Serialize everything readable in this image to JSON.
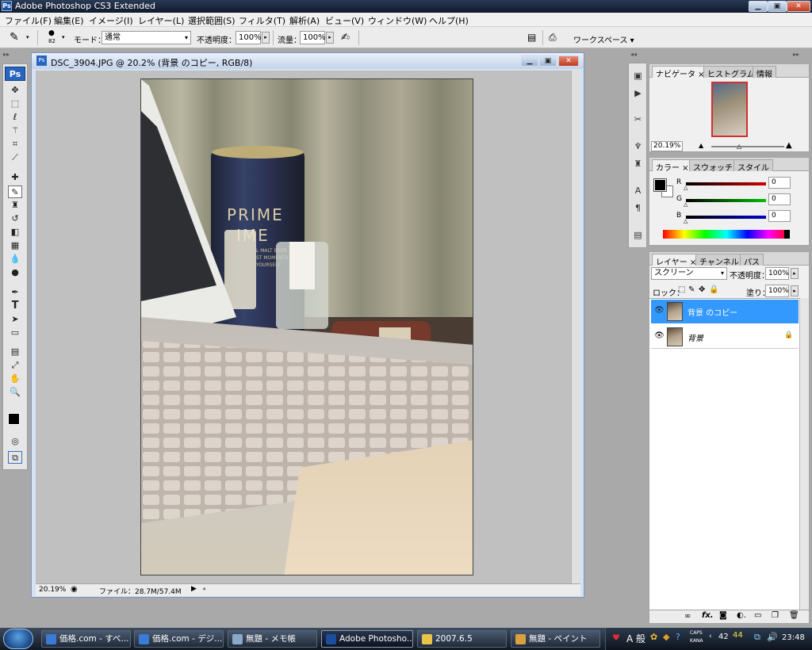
{
  "app": {
    "title": "Adobe Photoshop CS3 Extended",
    "logo": "Ps"
  },
  "menu": [
    "ファイル(F)",
    "編集(E)",
    "イメージ(I)",
    "レイヤー(L)",
    "選択範囲(S)",
    "フィルタ(T)",
    "解析(A)",
    "ビュー(V)",
    "ウィンドウ(W)",
    "ヘルプ(H)"
  ],
  "options": {
    "brush_size": "82",
    "mode_label": "モード：",
    "mode_value": "通常",
    "opacity_label": "不透明度：",
    "opacity_value": "100%",
    "flow_label": "流量：",
    "flow_value": "100%",
    "workspace": "ワークスペース ▾"
  },
  "document": {
    "title": "DSC_3904.JPG @ 20.2% (背景 のコピー, RGB/8)",
    "zoom": "20.19%",
    "file_info": "ファイル：28.7M/57.4M"
  },
  "photo": {
    "can_text_1": "PRIME",
    "can_text_2": "IME",
    "can_small_1": "L MALT BEER",
    "can_small_2": "ST MOMENTS",
    "can_small_3": "YOURSELF"
  },
  "navigator": {
    "tabs": [
      "ナビゲータ",
      "ヒストグラム",
      "情報"
    ],
    "zoom": "20.19%"
  },
  "color": {
    "tabs": [
      "カラー",
      "スウォッチ",
      "スタイル"
    ],
    "r_label": "R",
    "g_label": "G",
    "b_label": "B",
    "r": "0",
    "g": "0",
    "b": "0",
    "r_color": "#d00000",
    "g_color": "#00a000",
    "b_color": "#0000c8"
  },
  "layers": {
    "tabs": [
      "レイヤー",
      "チャンネル",
      "パス"
    ],
    "blend": "スクリーン",
    "opacity_label": "不透明度：",
    "opacity": "100%",
    "lock_label": "ロック：",
    "fill_label": "塗り：",
    "fill": "100%",
    "items": [
      {
        "name": "背景 のコピー",
        "selected": true
      },
      {
        "name": "背景",
        "locked": true
      }
    ],
    "selected_color": "#3399ff"
  },
  "taskbar": [
    {
      "label": "価格.com - すべ...",
      "color": "#3a7bd5"
    },
    {
      "label": "価格.com - デジ...",
      "color": "#3a7bd5"
    },
    {
      "label": "無題 - メモ帳",
      "color": "#8aa8c8"
    },
    {
      "label": "Adobe Photosho...",
      "color": "#1b4f9e",
      "active": true
    },
    {
      "label": "2007.6.5",
      "color": "#e8c548"
    },
    {
      "label": "無題 - ペイント",
      "color": "#d8a040"
    }
  ],
  "tray": {
    "ime": "A 般",
    "caps": "CAPS",
    "kana": "KANA",
    "temp1": "42",
    "temp2": "44",
    "time": "23:48"
  }
}
